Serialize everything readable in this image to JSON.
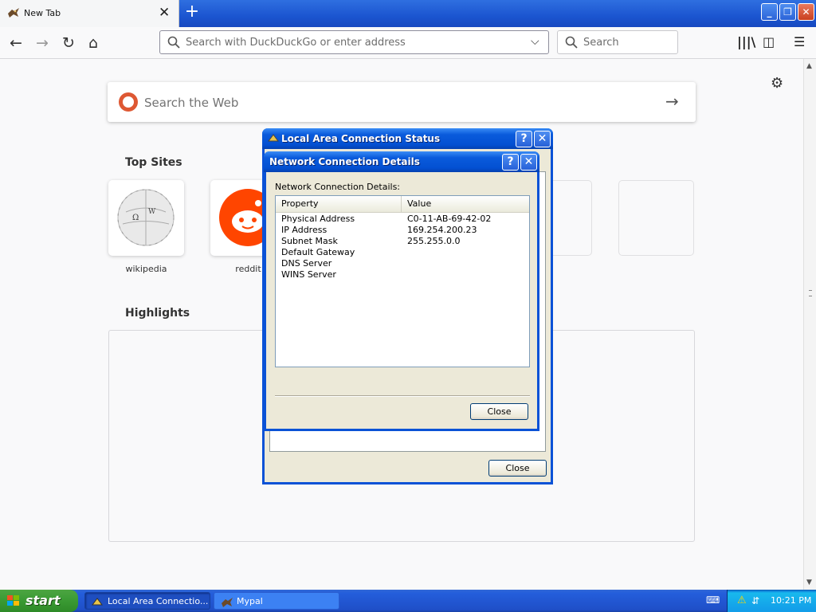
{
  "browser": {
    "tab_title": "New Tab",
    "new_tab_symbol": "+",
    "url_placeholder": "Search with DuckDuckGo or enter address",
    "search_placeholder": "Search",
    "window_controls": {
      "minimize": "_",
      "restore": "❐",
      "close": "✕"
    }
  },
  "newtab": {
    "web_search_placeholder": "Search the Web",
    "top_sites_heading": "Top Sites",
    "highlights_heading": "Highlights",
    "top_sites": [
      {
        "label": "wikipedia",
        "icon": "wikipedia-icon"
      },
      {
        "label": "reddit",
        "icon": "reddit-icon"
      }
    ]
  },
  "status_dialog": {
    "title": "Local Area Connection Status",
    "close_label": "Close",
    "help_symbol": "?",
    "close_symbol": "✕"
  },
  "details_dialog": {
    "title": "Network Connection Details",
    "group_label": "Network Connection Details:",
    "columns": [
      "Property",
      "Value"
    ],
    "rows": [
      {
        "property": "Physical Address",
        "value": "C0-11-AB-69-42-02"
      },
      {
        "property": "IP Address",
        "value": "169.254.200.23"
      },
      {
        "property": "Subnet Mask",
        "value": "255.255.0.0"
      },
      {
        "property": "Default Gateway",
        "value": ""
      },
      {
        "property": "DNS Server",
        "value": ""
      },
      {
        "property": "WINS Server",
        "value": ""
      }
    ],
    "close_label": "Close",
    "help_symbol": "?",
    "close_symbol": "✕"
  },
  "taskbar": {
    "start_label": "start",
    "tasks": [
      {
        "label": "Local Area Connectio...",
        "active": true
      },
      {
        "label": "Mypal",
        "active": false
      }
    ],
    "clock": "10:21 PM"
  },
  "colors": {
    "xp_blue": "#0a52d6",
    "start_green": "#3a9a33",
    "ddg_orange": "#de5833",
    "reddit_orange": "#ff4500"
  }
}
